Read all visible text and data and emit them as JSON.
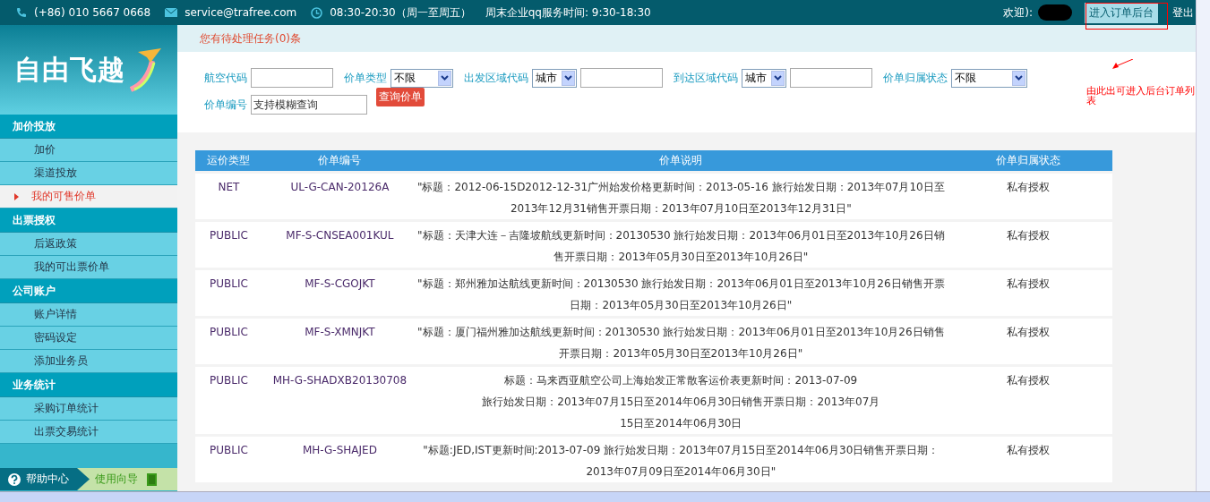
{
  "top_bar": {
    "phone": "(+86) 010 5667 0668",
    "email": "service@trafree.com",
    "hours": "08:30-20:30（周一至周五）",
    "weekend": "周末企业qq服务时间: 9:30-18:30",
    "welcome": "欢迎):",
    "backend_button": "进入订单后台",
    "logout": "登出"
  },
  "annotation": {
    "text": "由此出可进入后台订单列表"
  },
  "logo": {
    "text": "自由飞越"
  },
  "sidebar": {
    "sections": [
      {
        "title": "加价投放",
        "items": [
          {
            "label": "加价",
            "selected": false
          },
          {
            "label": "渠道投放",
            "selected": false
          },
          {
            "label": "我的可售价单",
            "selected": true
          }
        ]
      },
      {
        "title": "出票授权",
        "items": [
          {
            "label": "后返政策",
            "selected": false
          },
          {
            "label": "我的可出票价单",
            "selected": false
          }
        ]
      },
      {
        "title": "公司账户",
        "items": [
          {
            "label": "账户详情",
            "selected": false
          },
          {
            "label": "密码设定",
            "selected": false
          },
          {
            "label": "添加业务员",
            "selected": false
          }
        ]
      },
      {
        "title": "业务统计",
        "items": [
          {
            "label": "采购订单统计",
            "selected": false
          },
          {
            "label": "出票交易统计",
            "selected": false
          }
        ]
      }
    ],
    "help": "帮助中心",
    "guide": "使用向导"
  },
  "notice": "您有待处理任务(0)条",
  "filters": [
    {
      "kind": "input",
      "label": "航空代码"
    },
    {
      "kind": "select",
      "label": "价单类型",
      "value": "不限"
    },
    {
      "kind": "select_input",
      "label": "出发区域代码",
      "value": "城市"
    },
    {
      "kind": "select_input",
      "label": "到达区域代码",
      "value": "城市"
    },
    {
      "kind": "select",
      "label": "价单归属状态",
      "value": "不限"
    },
    {
      "kind": "input",
      "label": "价单编号",
      "placeholder": "支持模糊查询"
    }
  ],
  "search_button": "查询价单",
  "table": {
    "columns": [
      "运价类型",
      "价单编号",
      "价单说明",
      "价单归属状态"
    ],
    "rows": [
      {
        "type": "NET",
        "code": "UL-G-CAN-20126A",
        "lines": [
          "\"标题：2012-06-15D2012-12-31广州始发价格更新时间：2013-05-16 旅行始发日期：2013年07月10日至",
          "2013年12月31销售开票日期：2013年07月10日至2013年12月31日\""
        ],
        "status": "私有授权"
      },
      {
        "type": "PUBLIC",
        "code": "MF-S-CNSEA001KUL",
        "lines": [
          "\"标题：天津大连－吉隆坡航线更新时间：20130530 旅行始发日期：2013年06月01日至2013年10月26日销",
          "售开票日期：2013年05月30日至2013年10月26日\""
        ],
        "status": "私有授权"
      },
      {
        "type": "PUBLIC",
        "code": "MF-S-CGOJKT",
        "lines": [
          "\"标题：郑州雅加达航线更新时间：20130530 旅行始发日期：2013年06月01日至2013年10月26日销售开票",
          "日期：2013年05月30日至2013年10月26日\""
        ],
        "status": "私有授权"
      },
      {
        "type": "PUBLIC",
        "code": "MF-S-XMNJKT",
        "lines": [
          "\"标题：厦门福州雅加达航线更新时间：20130530 旅行始发日期：2013年06月01日至2013年10月26日销售",
          "开票日期：2013年05月30日至2013年10月26日\""
        ],
        "status": "私有授权"
      },
      {
        "type": "PUBLIC",
        "code": "MH-G-SHADXB20130708",
        "lines": [
          "标题：马来西亚航空公司上海始发正常散客运价表更新时间：2013-07-09",
          "旅行始发日期：2013年07月15日至2014年06月30日销售开票日期：2013年07月",
          "15日至2014年06月30日"
        ],
        "status": "私有授权"
      },
      {
        "type": "PUBLIC",
        "code": "MH-G-SHAJED",
        "lines": [
          "\"标题:JED,IST更新时间:2013-07-09 旅行始发日期：2013年07月15日至2014年06月30日销售开票日期：",
          "2013年07月09日至2014年06月30日\""
        ],
        "status": "私有授权"
      }
    ]
  }
}
